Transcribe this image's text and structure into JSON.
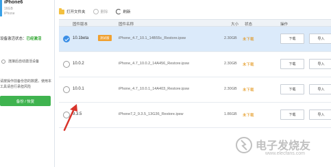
{
  "sidebar": {
    "device_name": "iPhone6",
    "device_sub1": "16GB",
    "device_sub2": "iPhone",
    "status_label": "设备激活状态：",
    "status_value": "已经激活",
    "checkbox_label": "连接后自动激活设备",
    "warning": "请按操作前备份您的数据，使用本工具请自行承担风险",
    "backup_button": "备份 / 恢复"
  },
  "toolbar": {
    "open_folder": "打开文件夹",
    "delete": "删除",
    "refresh": "刷新"
  },
  "table": {
    "headers": {
      "version": "固件版本",
      "name": "固件名称",
      "size": "大小",
      "status": "状态",
      "action": "操作"
    },
    "rows": [
      {
        "version": "10.1beta",
        "badge": "测试版",
        "name": "iPhone_4.7_10.1_14B55c_Restore.ipsw",
        "size": "2.30GB",
        "status": "未下载",
        "download": "下载",
        "import": "导入",
        "selected": true
      },
      {
        "version": "10.0.2",
        "badge": "",
        "name": "iPhone_4.7_10.0.2_14A456_Restore.ipsw",
        "size": "2.30GB",
        "status": "未下载",
        "download": "下载",
        "import": "导入",
        "selected": false
      },
      {
        "version": "10.0.1",
        "badge": "",
        "name": "iPhone_4.7_10.0.1_14A403_Restore.ipsw",
        "size": "2.30GB",
        "status": "未下载",
        "download": "下载",
        "import": "导入",
        "selected": false
      },
      {
        "version": "9.3.5",
        "badge": "",
        "name": "iPhone7,2_9.3.5_13G36_Restore.ipsw",
        "size": "1.86GB",
        "status": "未下载",
        "download": "下载",
        "import": "导入",
        "selected": false
      }
    ]
  },
  "watermark": {
    "text": "电子发烧友",
    "url": "www.elecfans.com"
  },
  "colors": {
    "accent_blue": "#3a8ee6",
    "selected_row": "#dbeafa",
    "status_orange": "#e08a00",
    "backup_green": "#3fb34f",
    "badge_orange": "#f0a030",
    "arrow_red": "#d9342b"
  }
}
